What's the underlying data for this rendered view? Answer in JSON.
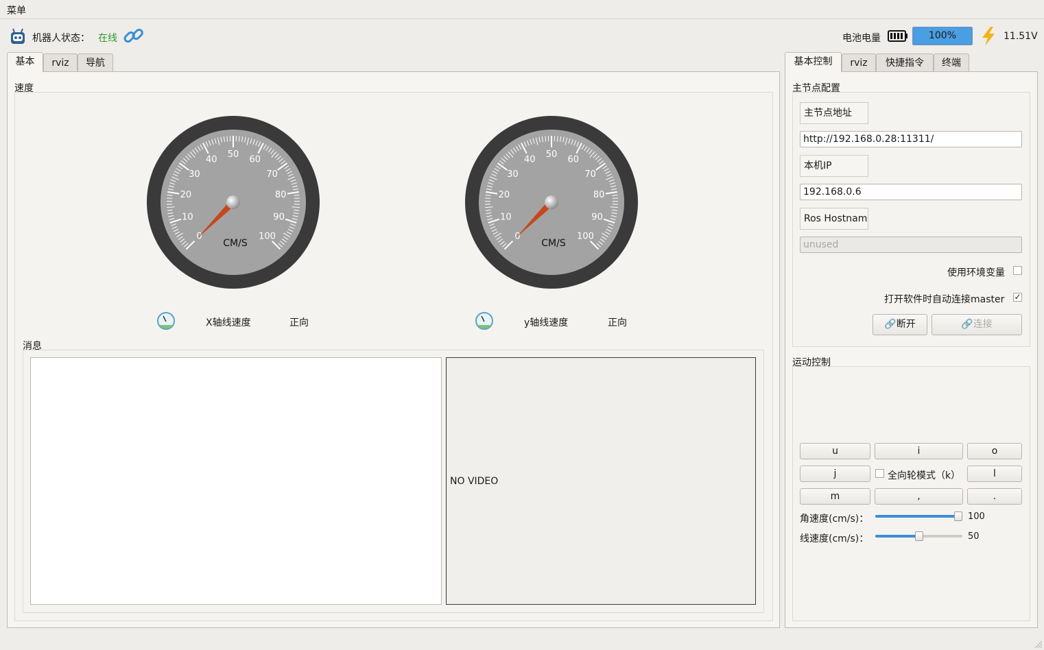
{
  "menubar": {
    "menu_label": "菜单"
  },
  "status": {
    "robot_status_label": "机器人状态：",
    "robot_status_value": "在线",
    "battery_label": "电池电量",
    "battery_percent": "100%",
    "battery_level": 1.0,
    "voltage": "11.51V"
  },
  "left_tabs": [
    "基本",
    "rviz",
    "导航"
  ],
  "speed_group": {
    "title": "速度",
    "gauges": [
      {
        "unit": "CM/S",
        "ticks": [
          "0",
          "10",
          "20",
          "30",
          "40",
          "50",
          "60",
          "70",
          "80",
          "90",
          "100"
        ],
        "value": 0,
        "axis_label": "X轴线速度",
        "direction": "正向"
      },
      {
        "unit": "CM/S",
        "ticks": [
          "0",
          "10",
          "20",
          "30",
          "40",
          "50",
          "60",
          "70",
          "80",
          "90",
          "100"
        ],
        "value": 0,
        "axis_label": "y轴线速度",
        "direction": "正向"
      }
    ]
  },
  "messages_group": {
    "title": "消息",
    "video_text": "NO VIDEO"
  },
  "right_tabs": [
    "基本控制",
    "rviz",
    "快捷指令",
    "终端"
  ],
  "master_config": {
    "title": "主节点配置",
    "master_uri_label": "主节点地址",
    "master_uri_value": "http://192.168.0.28:11311/",
    "local_ip_label": "本机IP",
    "local_ip_value": "192.168.0.6",
    "hostname_label": "Ros Hostname",
    "hostname_value": "unused",
    "use_env_label": "使用环境变量",
    "use_env_checked": false,
    "auto_connect_label": "打开软件时自动连接master",
    "auto_connect_checked": true,
    "disconnect_label": "断开",
    "connect_label": "连接"
  },
  "motion_control": {
    "title": "运动控制",
    "keys_row1": [
      "u",
      "i",
      "o"
    ],
    "keys_row2_left": "j",
    "omni_label": "全向轮模式（k）",
    "omni_checked": false,
    "keys_row2_right": "l",
    "keys_row3": [
      "m",
      ",",
      "."
    ],
    "angular_label": "角速度(cm/s)：",
    "angular_value": "100",
    "angular_fraction": 1.0,
    "linear_label": "线速度(cm/s)：",
    "linear_value": "50",
    "linear_fraction": 0.5
  }
}
